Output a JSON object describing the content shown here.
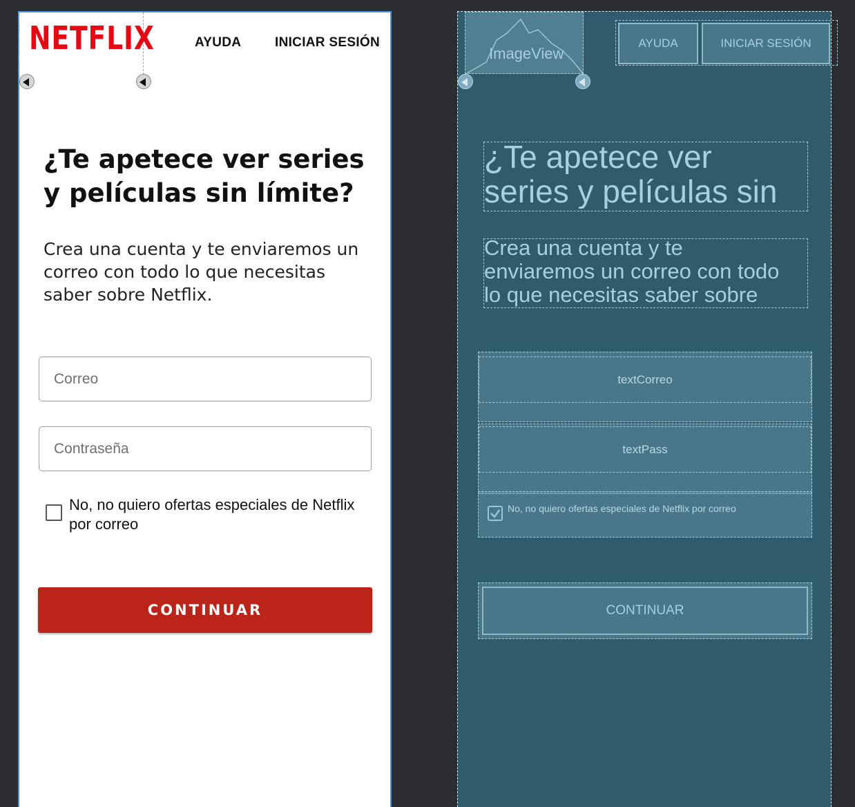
{
  "design": {
    "logo": "NETFLIX",
    "nav": {
      "help": "AYUDA",
      "login": "INICIAR SESIÓN"
    },
    "headline": "¿Te apetece ver series y películas sin límite?",
    "subtitle": "Crea una cuenta y te enviaremos un correo con todo lo que necesitas saber sobre Netflix.",
    "email": {
      "placeholder": "Correo",
      "value": ""
    },
    "password": {
      "placeholder": "Contraseña",
      "value": ""
    },
    "checkbox": {
      "label": "No, no quiero ofertas especiales de Netflix por correo",
      "checked": false
    },
    "continue_label": "CONTINUAR",
    "colors": {
      "brand": "#e50914",
      "button": "#bb2419"
    }
  },
  "blueprint": {
    "image_label": "ImageView",
    "nav": {
      "help": "AYUDA",
      "login": "INICIAR SESIÓN"
    },
    "headline_line1": "¿Te apetece ver",
    "headline_line2": "series y películas sin",
    "subtitle_line1": "Crea una cuenta y te",
    "subtitle_line2": "enviaremos un correo con todo",
    "subtitle_line3": "lo que necesitas saber sobre",
    "email_id": "textCorreo",
    "password_id": "textPass",
    "checkbox_label": "No, no quiero ofertas especiales de Netflix por correo",
    "continue_label": "CONTINUAR",
    "colors": {
      "background": "#305b6c",
      "outline": "#a9cbd8"
    }
  }
}
